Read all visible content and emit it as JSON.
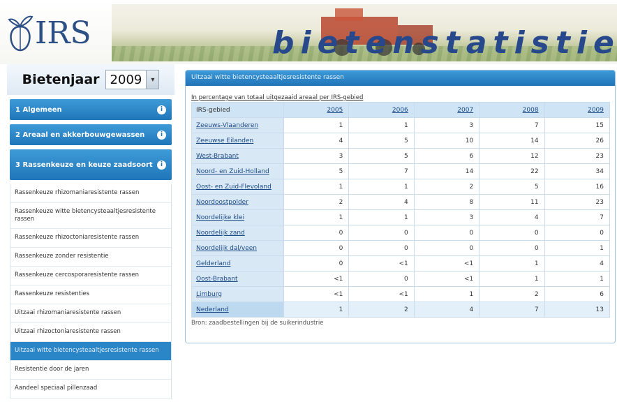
{
  "header": {
    "logo_text": "IRS",
    "site_title": "bietenstatistiek"
  },
  "sidebar": {
    "year_label": "Bietenjaar",
    "year_value": "2009",
    "sections": [
      {
        "label": "1 Algemeen",
        "info": "i"
      },
      {
        "label": "2 Areaal en akkerbouwgewassen",
        "info": "i"
      },
      {
        "label": "3 Rassenkeuze en keuze zaadsoort",
        "info": "i"
      }
    ],
    "items": [
      {
        "label": "Rassenkeuze rhizomaniaresistente rassen"
      },
      {
        "label": "Rassenkeuze witte bietencysteaaltjesresistente rassen"
      },
      {
        "label": "Rassenkeuze rhizoctoniaresistente rassen"
      },
      {
        "label": "Rassenkeuze zonder resistentie"
      },
      {
        "label": "Rassenkeuze cercosporaresistente rassen"
      },
      {
        "label": "Rassenkeuze resistenties"
      },
      {
        "label": "Uitzaai rhizomaniaresistente rassen"
      },
      {
        "label": "Uitzaai rhizoctoniaresistente rassen"
      },
      {
        "label": "Uitzaai witte bietencysteaaltjesresistente rassen"
      },
      {
        "label": "Resistentie door de jaren"
      },
      {
        "label": "Aandeel speciaal pillenzaad"
      }
    ]
  },
  "panel": {
    "title": "Uitzaai witte bietencysteaaltjesresistente rassen",
    "caption": "In percentage van totaal uitgezaaid areaal per IRS-gebied",
    "source": "Bron: zaadbestellingen bij de suikerindustrie",
    "table": {
      "header_first": "IRS-gebied",
      "years": [
        "2005",
        "2006",
        "2007",
        "2008",
        "2009"
      ],
      "rows": [
        {
          "region": "Zeeuws-Vlaanderen",
          "values": [
            "1",
            "1",
            "3",
            "7",
            "15"
          ]
        },
        {
          "region": "Zeeuwse Eilanden",
          "values": [
            "4",
            "5",
            "10",
            "14",
            "26"
          ]
        },
        {
          "region": "West-Brabant",
          "values": [
            "3",
            "5",
            "6",
            "12",
            "23"
          ]
        },
        {
          "region": "Noord- en Zuid-Holland",
          "values": [
            "5",
            "7",
            "14",
            "22",
            "34"
          ]
        },
        {
          "region": "Oost- en Zuid-Flevoland",
          "values": [
            "1",
            "1",
            "2",
            "5",
            "16"
          ]
        },
        {
          "region": "Noordoostpolder",
          "values": [
            "2",
            "4",
            "8",
            "11",
            "23"
          ]
        },
        {
          "region": "Noordelijke klei",
          "values": [
            "1",
            "1",
            "3",
            "4",
            "7"
          ]
        },
        {
          "region": "Noordelijk zand",
          "values": [
            "0",
            "0",
            "0",
            "0",
            "0"
          ]
        },
        {
          "region": "Noordelijk dal/veen",
          "values": [
            "0",
            "0",
            "0",
            "0",
            "1"
          ]
        },
        {
          "region": "Gelderland",
          "values": [
            "0",
            "<1",
            "<1",
            "1",
            "4"
          ]
        },
        {
          "region": "Oost-Brabant",
          "values": [
            "<1",
            "0",
            "<1",
            "1",
            "1"
          ]
        },
        {
          "region": "Limburg",
          "values": [
            "<1",
            "<1",
            "1",
            "2",
            "6"
          ]
        },
        {
          "region": "Nederland",
          "values": [
            "1",
            "2",
            "4",
            "7",
            "13"
          ]
        }
      ]
    }
  }
}
